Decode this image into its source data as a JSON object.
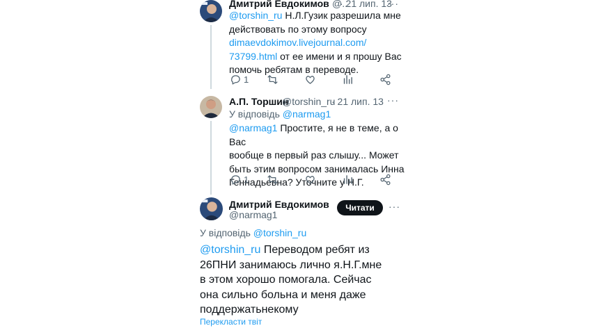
{
  "tweet1": {
    "author_name": "Дмитрий Евдокимов",
    "handle_trunc": "@...",
    "date": "· 21 лип. 13",
    "mention": "@torshin_ru",
    "text_a": " Н.Л.Гузик разрешила мне",
    "text_b": "действовать по этому вопросу",
    "link_a": "dimaevdokimov.livejournal.com/",
    "link_b": "73799.html",
    "text_c": " от ее имени и я прошу Вас",
    "text_d": "помочь ребятам в переводе.",
    "reply_count": "1"
  },
  "tweet2": {
    "author_name": "А.П. Торшин",
    "handle": "@torshin_ru",
    "date": "· 21 лип. 13",
    "reply_to_label": "У відповідь",
    "reply_to_handle": "@narmag1",
    "mention": "@narmag1",
    "text_a": " Простите, я не в теме, а о Вас",
    "text_b": "вообще в первый раз слышу... Может",
    "text_c": "быть этим вопросом занималась Инна",
    "text_d": "Геннадьевна? Уточните у Н.Г.",
    "reply_count": "1"
  },
  "tweet3": {
    "author_name": "Дмитрий Евдокимов",
    "handle": "@narmag1",
    "follow_label": "Читати",
    "reply_to_label": "У відповідь",
    "reply_to_handle": "@torshin_ru",
    "mention": "@torshin_ru",
    "text_a": " Переводом ребят из",
    "text_b": "26ПНИ занимаюсь лично я.Н.Г.мне",
    "text_c": "в этом хорошо помогала. Сейчас",
    "text_d": "она сильно больна и меня даже",
    "text_e": "поддержатьнекому",
    "translate_label": "Перекласти твіт"
  },
  "more_glyph": "···",
  "colors": {
    "link": "#1d9bf0",
    "text": "#0f1419",
    "muted": "#536471",
    "button": "#0f1419"
  },
  "icons": [
    "reply-icon",
    "retweet-icon",
    "like-icon",
    "views-icon",
    "share-icon",
    "more-icon"
  ]
}
